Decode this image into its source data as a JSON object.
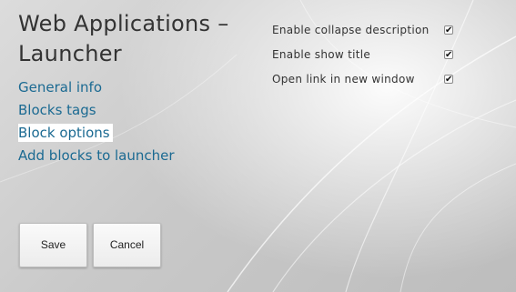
{
  "header": {
    "title": "Web Applications – Launcher"
  },
  "nav": {
    "items": [
      {
        "label": "General info",
        "active": false
      },
      {
        "label": "Blocks tags",
        "active": false
      },
      {
        "label": "Block options",
        "active": true
      },
      {
        "label": "Add blocks to launcher",
        "active": false
      }
    ]
  },
  "options": [
    {
      "label": "Enable collapse description",
      "checked": true
    },
    {
      "label": "Enable show title",
      "checked": true
    },
    {
      "label": "Open link in new window",
      "checked": true
    }
  ],
  "buttons": {
    "save_label": "Save",
    "cancel_label": "Cancel"
  },
  "colors": {
    "link": "#1b6a92",
    "title_text": "#333333",
    "active_highlight": "#ffffff"
  }
}
